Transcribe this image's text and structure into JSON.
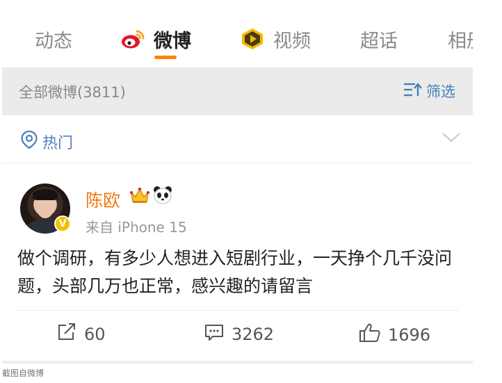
{
  "tabs": [
    {
      "label": "动态"
    },
    {
      "label": "微博",
      "icon": "weibo-logo-icon",
      "active": true
    },
    {
      "label": "视频",
      "icon": "video-play-icon"
    },
    {
      "label": "超话"
    },
    {
      "label": "相册"
    }
  ],
  "filter": {
    "count_label": "全部微博(3811)",
    "filter_label": "筛选"
  },
  "hot": {
    "label": "热门"
  },
  "post": {
    "username": "陈欧",
    "badges": [
      "crown-icon",
      "panda-icon"
    ],
    "source": "来自 iPhone 15",
    "text": "做个调研，有多少人想进入短剧行业，一天挣个几千没问题，头部几万也正常，感兴趣的请留言",
    "repost_count": "60",
    "comment_count": "3262",
    "like_count": "1696"
  },
  "caption": "截图自微博",
  "colors": {
    "accent_orange": "#ff8200",
    "link_blue": "#4a7fb8",
    "username_orange": "#f07a12",
    "filter_bg": "#ebebeb"
  }
}
